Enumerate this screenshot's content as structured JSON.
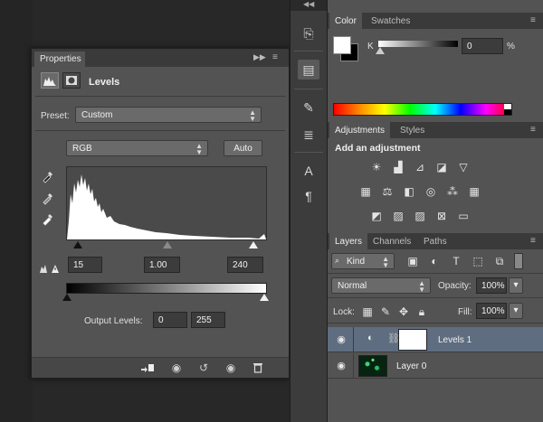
{
  "properties": {
    "tab_label": "Properties",
    "panel_title": "Levels",
    "preset_label": "Preset:",
    "preset_value": "Custom",
    "channel_value": "RGB",
    "auto_label": "Auto",
    "input_black": "15",
    "input_mid": "1.00",
    "input_white": "240",
    "output_label": "Output Levels:",
    "output_black": "0",
    "output_white": "255"
  },
  "color_panel": {
    "tabs": [
      "Color",
      "Swatches"
    ],
    "channel_label": "K",
    "channel_value": "0",
    "unit": "%"
  },
  "adjustments_panel": {
    "tabs": [
      "Adjustments",
      "Styles"
    ],
    "heading": "Add an adjustment"
  },
  "layers_panel": {
    "tabs": [
      "Layers",
      "Channels",
      "Paths"
    ],
    "filter_kind": "Kind",
    "blend_mode": "Normal",
    "opacity_label": "Opacity:",
    "opacity_value": "100%",
    "lock_label": "Lock:",
    "fill_label": "Fill:",
    "fill_value": "100%",
    "layers": [
      {
        "name": "Levels 1",
        "selected": true
      },
      {
        "name": "Layer 0",
        "selected": false
      }
    ]
  },
  "colors": {
    "panel_bg": "#535353",
    "selected_layer": "#5f6d80"
  }
}
